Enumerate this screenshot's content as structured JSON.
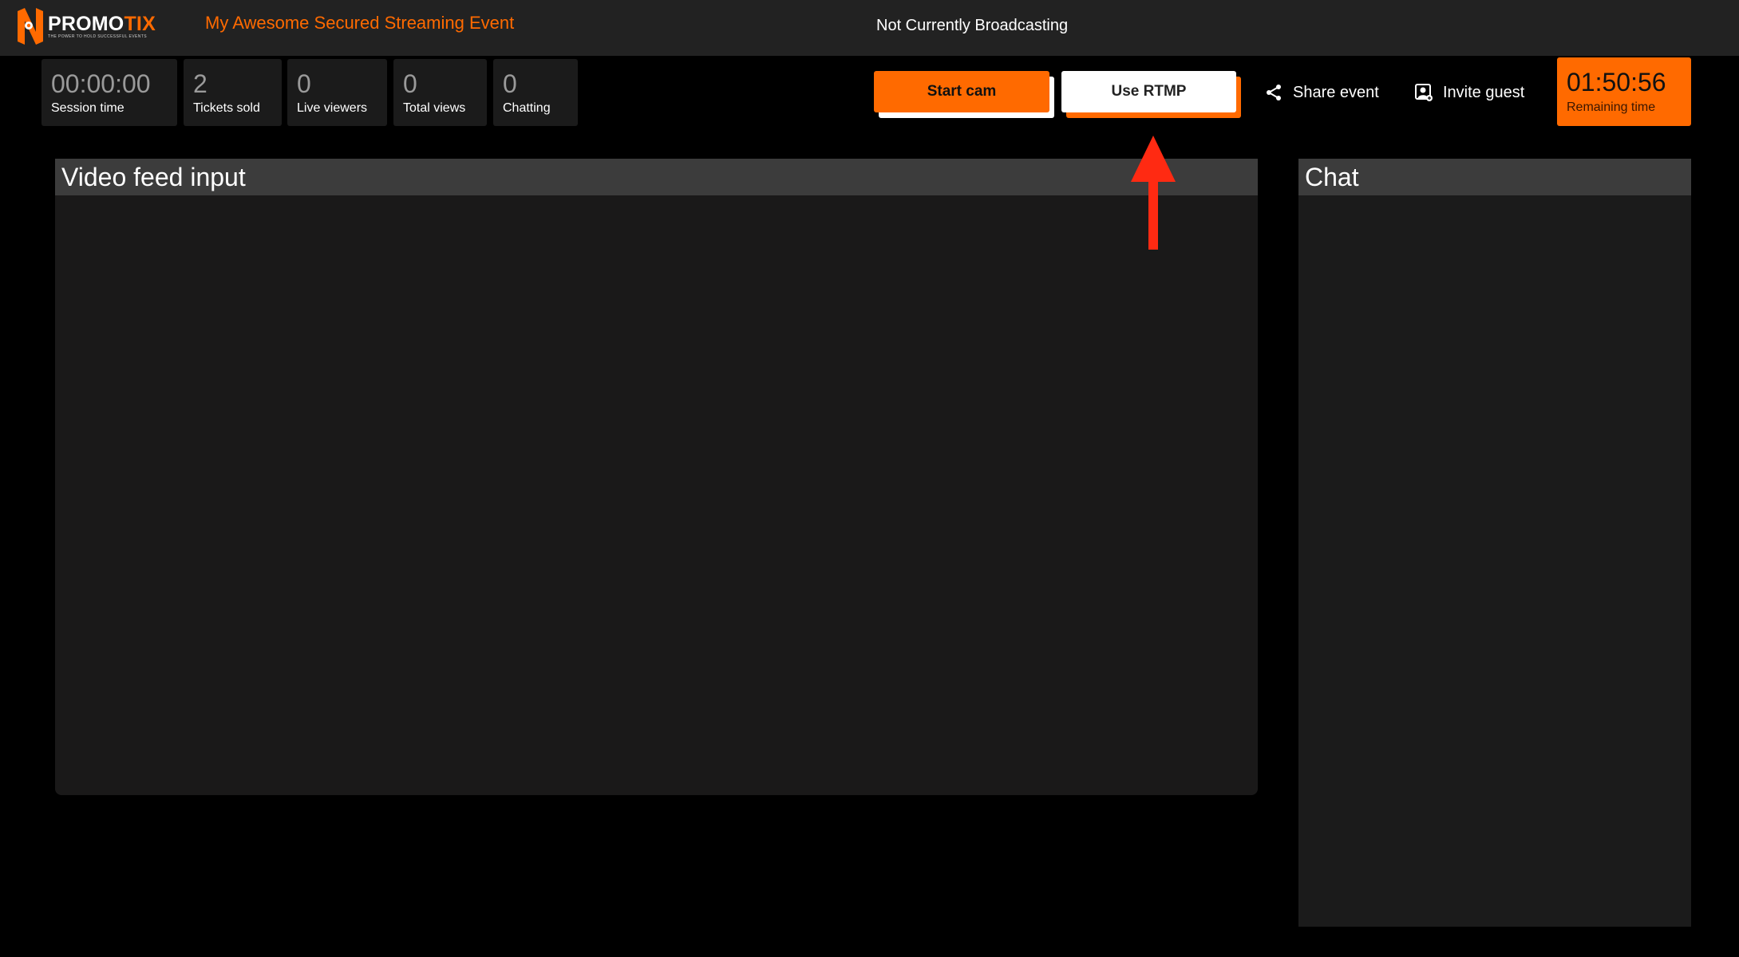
{
  "header": {
    "logo_text_part1": "PROMO",
    "logo_text_part2": "TIX",
    "logo_tagline": "THE POWER TO HOLD SUCCESSFUL EVENTS",
    "event_title": "My Awesome Secured Streaming Event",
    "broadcast_status": "Not Currently Broadcasting"
  },
  "stats": [
    {
      "value": "00:00:00",
      "label": "Session time"
    },
    {
      "value": "2",
      "label": "Tickets sold"
    },
    {
      "value": "0",
      "label": "Live viewers"
    },
    {
      "value": "0",
      "label": "Total views"
    },
    {
      "value": "0",
      "label": "Chatting"
    }
  ],
  "actions": {
    "start_cam": "Start cam",
    "use_rtmp": "Use RTMP",
    "share_event": "Share event",
    "invite_guest": "Invite guest"
  },
  "remaining": {
    "value": "01:50:56",
    "label": "Remaining time"
  },
  "panels": {
    "video_title": "Video feed input",
    "chat_title": "Chat"
  },
  "icons": {
    "logo": "promotix-logo-icon",
    "share": "share-icon",
    "invite": "invite-guest-icon",
    "annotation": "red-up-arrow-icon"
  },
  "colors": {
    "accent": "#ff6a00",
    "topbar": "#222222",
    "background": "#000000",
    "panel_header": "#3c3c3c",
    "panel_body": "#1a1919",
    "annotation_arrow": "#ff2a12"
  }
}
